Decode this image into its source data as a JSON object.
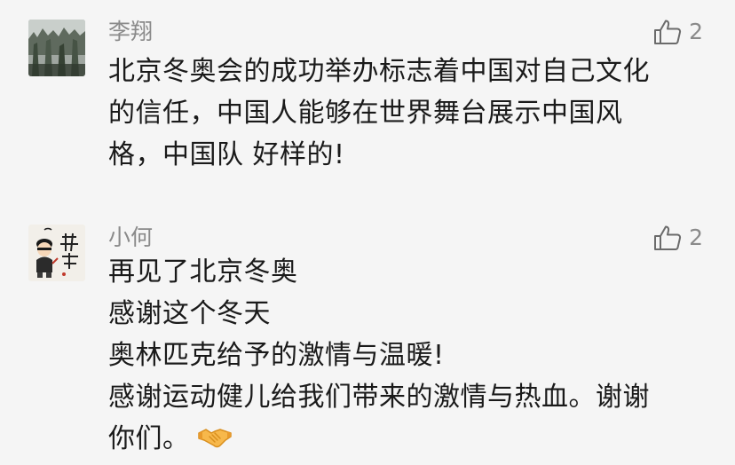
{
  "comments": [
    {
      "username": "李翔",
      "likes": "2",
      "avatar": "stone-forest-photo",
      "lines": [
        "北京冬奥会的成功举办标志着中国对自己文化",
        "的信任，中国人能够在世界舞台展示中国风",
        "格，中国队 好样的!"
      ]
    },
    {
      "username": "小何",
      "likes": "2",
      "avatar": "cartoon-character-calligraphy",
      "lines": [
        "再见了北京冬奥",
        "感谢这个冬天",
        "奥林匹克给予的激情与温暖!",
        "感谢运动健儿给我们带来的激情与热血。谢谢",
        "你们。"
      ],
      "trailing_emoji": "handshake-emoji"
    }
  ],
  "colors": {
    "background": "#f5f5f5",
    "username": "#8a8a8a",
    "body": "#1a1a1a",
    "like_icon": "#6b6b6b"
  }
}
